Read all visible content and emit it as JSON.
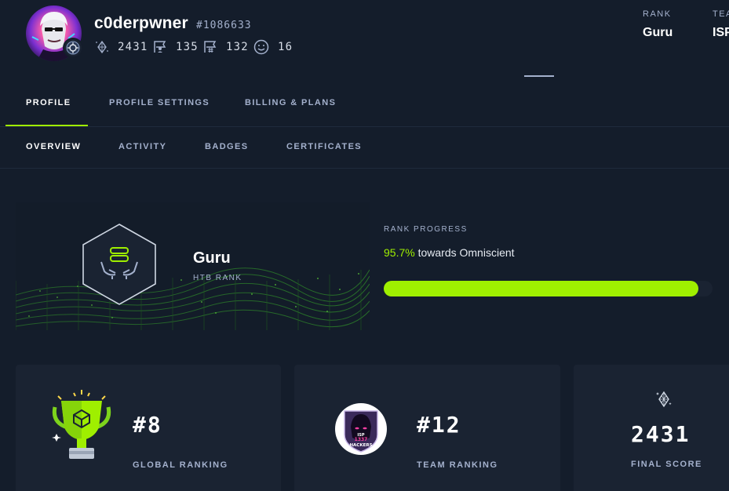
{
  "user": {
    "username": "c0derpwner",
    "id": "#1086633",
    "stats": [
      {
        "icon": "points-icon",
        "value": "2431"
      },
      {
        "icon": "user-flag-icon",
        "value": "135"
      },
      {
        "icon": "system-flag-icon",
        "value": "132"
      },
      {
        "icon": "respect-icon",
        "value": "16"
      }
    ]
  },
  "header": {
    "rank_label": "RANK",
    "rank_value": "Guru",
    "team_label": "TEAM",
    "team_value": "ISP"
  },
  "tabs_primary": [
    {
      "label": "PROFILE",
      "active": true
    },
    {
      "label": "PROFILE SETTINGS",
      "active": false
    },
    {
      "label": "BILLING & PLANS",
      "active": false
    }
  ],
  "tabs_secondary": [
    {
      "label": "OVERVIEW",
      "active": true
    },
    {
      "label": "ACTIVITY",
      "active": false
    },
    {
      "label": "BADGES",
      "active": false
    },
    {
      "label": "CERTIFICATES",
      "active": false
    }
  ],
  "rank": {
    "name": "Guru",
    "subtitle": "HTB RANK",
    "progress_label": "RANK PROGRESS",
    "progress_pct_text": "95.7%",
    "progress_text": "towards Omniscient",
    "progress_value": 0.957
  },
  "cards": {
    "global": {
      "value": "#8",
      "label": "GLOBAL RANKING"
    },
    "team": {
      "value": "#12",
      "label": "TEAM RANKING",
      "logo_text_1": "ISP",
      "logo_text_2": "1337",
      "logo_text_3": "HACKERS"
    },
    "score": {
      "value": "2431",
      "label": "FINAL SCORE"
    }
  },
  "colors": {
    "accent": "#9fef00",
    "background": "#141d2b",
    "card": "#1a2332",
    "muted": "#a4b1cd"
  }
}
